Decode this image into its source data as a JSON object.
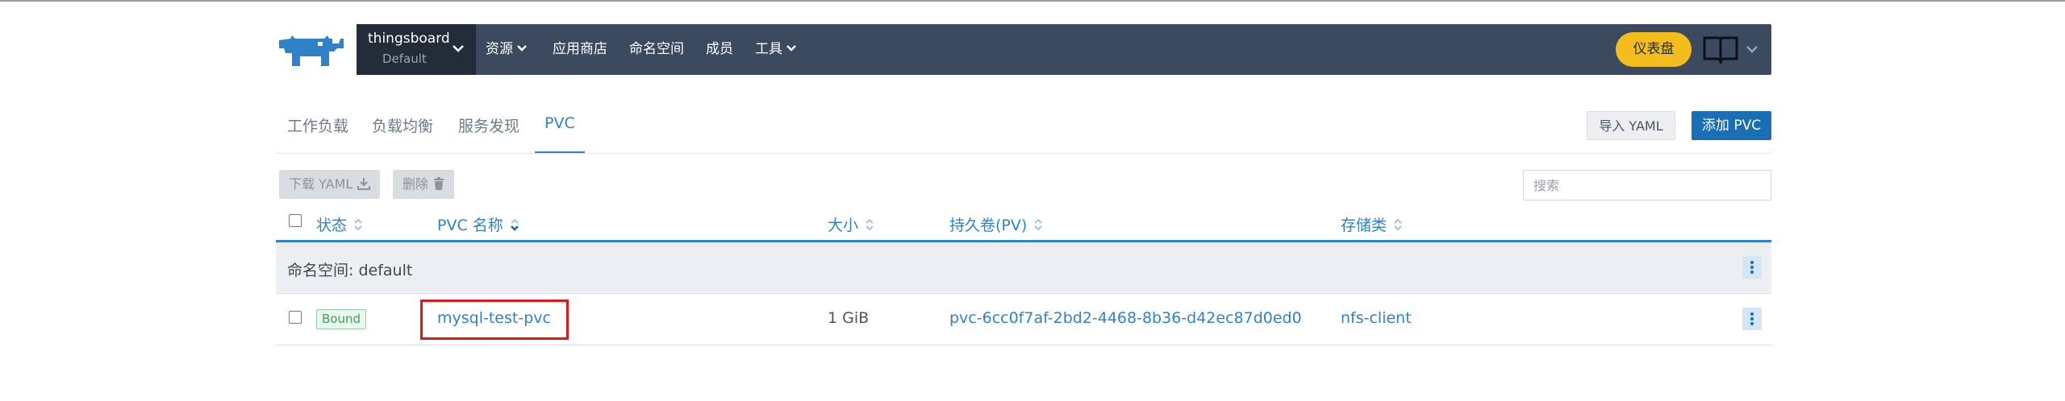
{
  "header": {
    "cluster": {
      "name": "thingsboard",
      "namespace": "Default"
    },
    "nav": [
      {
        "label": "资源",
        "has_caret": true
      },
      {
        "label": "应用商店",
        "has_caret": false
      },
      {
        "label": "命名空间",
        "has_caret": false
      },
      {
        "label": "成员",
        "has_caret": false
      },
      {
        "label": "工具",
        "has_caret": true
      }
    ],
    "dashboard_button": "仪表盘",
    "colors": {
      "bar": "#3b4a5e",
      "cluster_bg": "#222c38",
      "dashboard": "#f2bd1d"
    }
  },
  "tabs": [
    {
      "label": "工作负载",
      "active": false
    },
    {
      "label": "负载均衡",
      "active": false
    },
    {
      "label": "服务发现",
      "active": false
    },
    {
      "label": "PVC",
      "active": true
    }
  ],
  "actions": {
    "import": "导入 YAML",
    "add": "添加 PVC"
  },
  "bulk": {
    "download": "下载 YAML",
    "delete": "删除"
  },
  "search": {
    "placeholder": "搜索",
    "value": ""
  },
  "table": {
    "columns": [
      "状态",
      "PVC 名称",
      "大小",
      "持久卷(PV)",
      "存储类"
    ],
    "group_label": "命名空间: default",
    "rows": [
      {
        "status": "Bound",
        "name": "mysql-test-pvc",
        "size": "1 GiB",
        "pv": "pvc-6cc0f7af-2bd2-4468-8b36-d42ec87d0ed0",
        "storage_class": "nfs-client"
      }
    ]
  },
  "accent": {
    "link": "#2f82c8",
    "highlight": "#e0161b",
    "bound_green": "#3aa45a"
  }
}
